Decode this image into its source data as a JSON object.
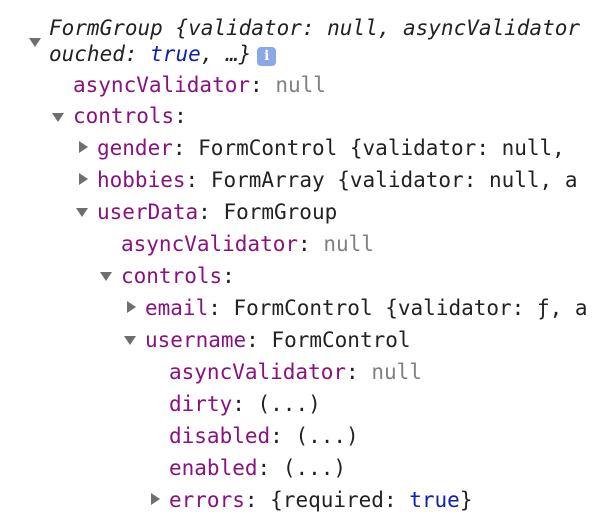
{
  "header": {
    "line1": "FormGroup {validator: null, asyncValidator",
    "line2_part1": "ouched: ",
    "line2_value": "true",
    "line2_part2": ", …}",
    "info_badge": "i"
  },
  "root": {
    "asyncValidator": {
      "key": "asyncValidator",
      "value": "null"
    },
    "controls": {
      "key": "controls",
      "gender": {
        "key": "gender",
        "type": "FormControl",
        "preview": "{validator: null, "
      },
      "hobbies": {
        "key": "hobbies",
        "type": "FormArray",
        "preview": "{validator: null, a"
      },
      "userData": {
        "key": "userData",
        "type": "FormGroup",
        "asyncValidator": {
          "key": "asyncValidator",
          "value": "null"
        },
        "controls": {
          "key": "controls",
          "email": {
            "key": "email",
            "type": "FormControl",
            "preview": "{validator: ƒ, a"
          },
          "username": {
            "key": "username",
            "type": "FormControl",
            "asyncValidator": {
              "key": "asyncValidator",
              "value": "null"
            },
            "dirty": {
              "key": "dirty",
              "value": "(...)"
            },
            "disabled": {
              "key": "disabled",
              "value": "(...)"
            },
            "enabled": {
              "key": "enabled",
              "value": "(...)"
            },
            "errors": {
              "key": "errors",
              "preview_open": "{required: ",
              "preview_value": "true",
              "preview_close": "}"
            }
          }
        }
      }
    }
  },
  "colors": {
    "key": "#881280",
    "null": "#808080",
    "keyword": "#0d22aa",
    "text": "#222222",
    "badge": "#8aa8e6",
    "arrow": "#6e6e6e"
  },
  "icons": [
    "expand-down-icon",
    "expand-right-icon",
    "info-icon"
  ]
}
